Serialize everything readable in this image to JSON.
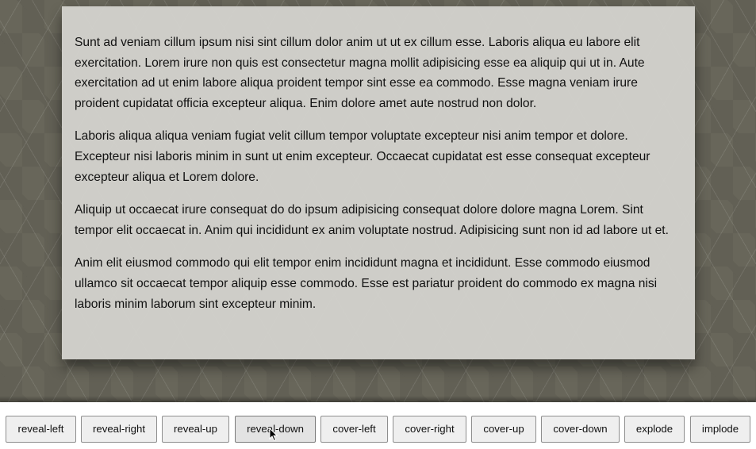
{
  "content": {
    "paragraphs": [
      "Sunt ad veniam cillum ipsum nisi sint cillum dolor anim ut ut ex cillum esse. Laboris aliqua eu labore elit exercitation. Lorem irure non quis est consectetur magna mollit adipisicing esse ea aliquip qui ut in. Aute exercitation ad ut enim labore aliqua proident tempor sint esse ea commodo. Esse magna veniam irure proident cupidatat officia excepteur aliqua. Enim dolore amet aute nostrud non dolor.",
      "Laboris aliqua aliqua veniam fugiat velit cillum tempor voluptate excepteur nisi anim tempor et dolore. Excepteur nisi laboris minim in sunt ut enim excepteur. Occaecat cupidatat est esse consequat excepteur excepteur aliqua et Lorem dolore.",
      "Aliquip ut occaecat irure consequat do do ipsum adipisicing consequat dolore dolore magna Lorem. Sint tempor elit occaecat in. Anim qui incididunt ex anim voluptate nostrud. Adipisicing sunt non id ad labore ut et.",
      "Anim elit eiusmod commodo qui elit tempor enim incididunt magna et incididunt. Esse commodo eiusmod ullamco sit occaecat tempor aliquip esse commodo. Esse est pariatur proident do commodo ex magna nisi laboris minim laborum sint excepteur minim."
    ]
  },
  "toolbar": {
    "buttons": [
      {
        "label": "reveal-left"
      },
      {
        "label": "reveal-right"
      },
      {
        "label": "reveal-up"
      },
      {
        "label": "reveal-down",
        "hovered": true
      },
      {
        "label": "cover-left"
      },
      {
        "label": "cover-right"
      },
      {
        "label": "cover-up"
      },
      {
        "label": "cover-down"
      },
      {
        "label": "explode"
      },
      {
        "label": "implode"
      }
    ]
  },
  "cursor": {
    "icon": "mouse-pointer-icon"
  },
  "colors": {
    "background_pattern": "#68665a",
    "panel": "#d6d5d1",
    "button": "#efefef"
  }
}
